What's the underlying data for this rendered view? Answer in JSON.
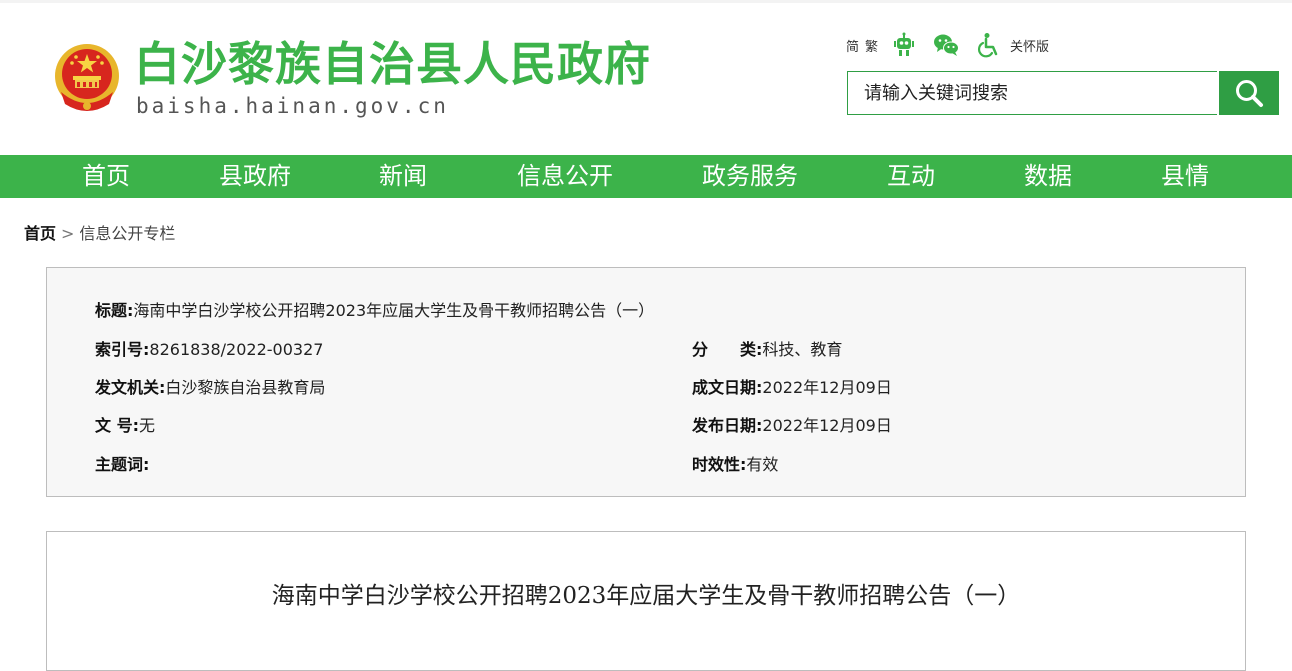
{
  "header": {
    "site_name": "白沙黎族自治县人民政府",
    "domain": "baisha.hainan.gov.cn",
    "emblem_icon": "national-emblem-icon",
    "tools": {
      "simplified": "简",
      "traditional": "繁",
      "robot_icon": "robot-icon",
      "wechat_icon": "wechat-icon",
      "accessibility_icon": "accessibility-icon",
      "care_mode": "关怀版"
    },
    "search": {
      "placeholder": "请输入关键词搜索",
      "icon": "search-icon"
    }
  },
  "nav": {
    "items": [
      {
        "label": "首页"
      },
      {
        "label": "县政府"
      },
      {
        "label": "新闻"
      },
      {
        "label": "信息公开"
      },
      {
        "label": "政务服务"
      },
      {
        "label": "互动"
      },
      {
        "label": "数据"
      },
      {
        "label": "县情"
      }
    ]
  },
  "breadcrumb": {
    "home": "首页",
    "separator": ">",
    "current": "信息公开专栏"
  },
  "info": {
    "title_label": "标题:",
    "title_value": "海南中学白沙学校公开招聘2023年应届大学生及骨干教师招聘公告（一）",
    "index_label": "索引号:",
    "index_value": "8261838/2022-00327",
    "category_label": "分　　类:",
    "category_value": "科技、教育",
    "issuer_label": "发文机关:",
    "issuer_value": "白沙黎族自治县教育局",
    "created_label": "成文日期:",
    "created_value": "2022年12月09日",
    "docno_label": "文  号:",
    "docno_value": "无",
    "published_label": "发布日期:",
    "published_value": "2022年12月09日",
    "keywords_label": "主题词:",
    "keywords_value": "",
    "validity_label": "时效性:",
    "validity_value": "有效"
  },
  "article": {
    "title": "海南中学白沙学校公开招聘2023年应届大学生及骨干教师招聘公告（一）"
  },
  "colors": {
    "brand_green": "#3cb34a",
    "search_green": "#2f9e44"
  }
}
